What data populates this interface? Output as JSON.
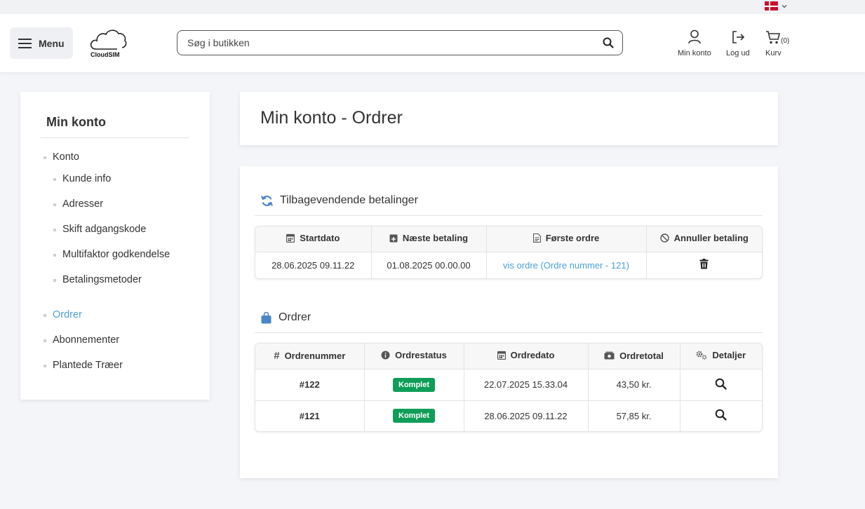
{
  "topbar": {
    "language": "da"
  },
  "header": {
    "menu_label": "Menu",
    "logo_text": "CloudSIM",
    "search_placeholder": "Søg i butikken",
    "account_label": "Min konto",
    "logout_label": "Log ud",
    "cart_label": "Kurv",
    "cart_count": "(0)"
  },
  "sidebar": {
    "title": "Min konto",
    "items": [
      {
        "label": "Konto",
        "active": false
      },
      {
        "label": "Kunde info",
        "active": false
      },
      {
        "label": "Adresser",
        "active": false
      },
      {
        "label": "Skift adgangskode",
        "active": false
      },
      {
        "label": "Multifaktor godkendelse",
        "active": false
      },
      {
        "label": "Betalingsmetoder",
        "active": false
      },
      {
        "label": "Ordrer",
        "active": true
      },
      {
        "label": "Abonnementer",
        "active": false
      },
      {
        "label": "Plantede Træer",
        "active": false
      }
    ]
  },
  "page_title": "Min konto - Ordrer",
  "recurring": {
    "title": "Tilbagevendende betalinger",
    "headers": [
      "Startdato",
      "Næste betaling",
      "Første ordre",
      "Annuller betaling"
    ],
    "rows": [
      {
        "start": "28.06.2025 09.11.22",
        "next": "01.08.2025 00.00.00",
        "first_order": "vis ordre (Ordre nummer - 121)"
      }
    ]
  },
  "orders": {
    "title": "Ordrer",
    "headers": [
      "Ordrenummer",
      "Ordrestatus",
      "Ordredato",
      "Ordretotal",
      "Detaljer"
    ],
    "rows": [
      {
        "number": "#122",
        "status": "Komplet",
        "date": "22.07.2025 15.33.04",
        "total": "43,50 kr."
      },
      {
        "number": "#121",
        "status": "Komplet",
        "date": "28.06.2025 09.11.22",
        "total": "57,85 kr."
      }
    ]
  },
  "colors": {
    "accent": "#4a9fd8",
    "status_complete": "#0f9d58",
    "icon_blue": "#4a86c8"
  }
}
